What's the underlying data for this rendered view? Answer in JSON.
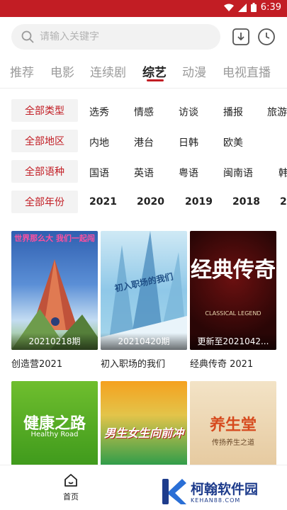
{
  "status": {
    "time": "6:39"
  },
  "search": {
    "placeholder": "请输入关键字"
  },
  "tabs": [
    {
      "label": "推荐"
    },
    {
      "label": "电影"
    },
    {
      "label": "连续剧"
    },
    {
      "label": "综艺"
    },
    {
      "label": "动漫"
    },
    {
      "label": "电视直播"
    }
  ],
  "active_tab": "综艺",
  "filters": [
    {
      "head": "全部类型",
      "options": [
        "选秀",
        "情感",
        "访谈",
        "播报",
        "旅游"
      ]
    },
    {
      "head": "全部地区",
      "options": [
        "内地",
        "港台",
        "日韩",
        "欧美"
      ]
    },
    {
      "head": "全部语种",
      "options": [
        "国语",
        "英语",
        "粤语",
        "闽南语",
        "韩"
      ]
    },
    {
      "head": "全部年份",
      "options": [
        "2021",
        "2020",
        "2019",
        "2018",
        "20"
      ]
    }
  ],
  "cards": [
    {
      "title": "创造营2021",
      "badge": "20210218期",
      "poster_text": "世界那么大 我们一起闯"
    },
    {
      "title": "初入职场的我们",
      "badge": "20210420期",
      "poster_text": "初入职场的我们"
    },
    {
      "title": "经典传奇 2021",
      "badge": "更新至2021042...",
      "poster_text": "经典传奇",
      "poster_sub": "CLASSICAL LEGEND"
    },
    {
      "title": "",
      "badge": "",
      "poster_text": "健康之路",
      "poster_sub": "Healthy Road"
    },
    {
      "title": "",
      "badge": "",
      "poster_text": "男生女生向前冲"
    },
    {
      "title": "",
      "badge": "",
      "poster_text": "养生堂",
      "poster_sub": "传扬养生之道"
    }
  ],
  "bottom_nav": {
    "home_label": "首页"
  },
  "watermark": {
    "name": "柯翰软件园",
    "url": "KEHAN88.COM"
  },
  "colors": {
    "accent": "#c21d24",
    "statusbar": "#c21d24"
  }
}
